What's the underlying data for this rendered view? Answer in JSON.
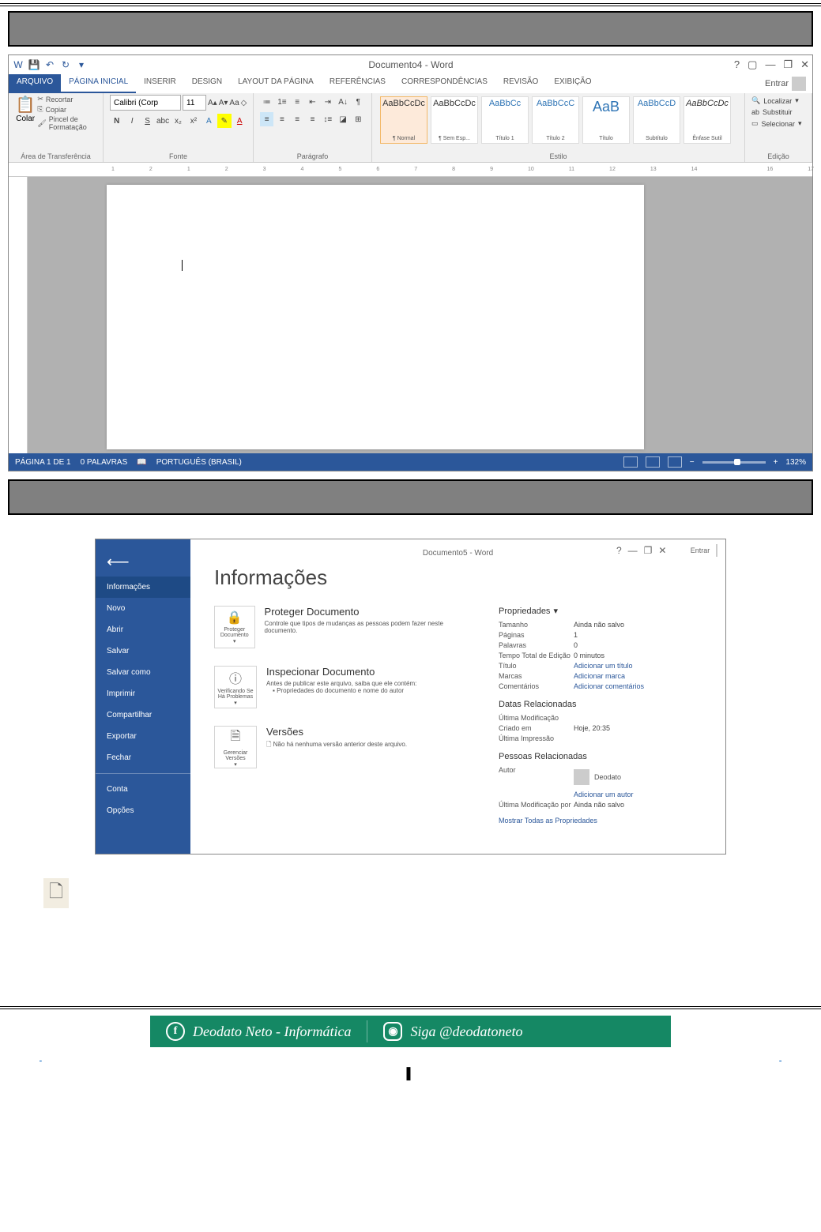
{
  "word_main": {
    "title": "Documento4 - Word",
    "signin": "Entrar",
    "qat_customize": "▾",
    "wincontrols": {
      "help": "?",
      "ribbon_opt": "▢",
      "minimize": "—",
      "restore": "❐",
      "close": "✕"
    },
    "tabs": {
      "file": "ARQUIVO",
      "home": "PÁGINA INICIAL",
      "insert": "INSERIR",
      "design": "DESIGN",
      "layout": "LAYOUT DA PÁGINA",
      "references": "REFERÊNCIAS",
      "mailings": "CORRESPONDÊNCIAS",
      "review": "REVISÃO",
      "view": "EXIBIÇÃO"
    },
    "clipboard": {
      "paste": "Colar",
      "cut": "Recortar",
      "copy": "Copiar",
      "painter": "Pincel de Formatação",
      "label": "Área de Transferência"
    },
    "font": {
      "name": "Calibri (Corp",
      "size": "11",
      "label": "Fonte"
    },
    "para": {
      "label": "Parágrafo"
    },
    "styles": {
      "label": "Estilo",
      "items": [
        {
          "preview": "AaBbCcDc",
          "name": "¶ Normal",
          "cls": ""
        },
        {
          "preview": "AaBbCcDc",
          "name": "¶ Sem Esp...",
          "cls": ""
        },
        {
          "preview": "AaBbCc",
          "name": "Título 1",
          "cls": "blue"
        },
        {
          "preview": "AaBbCcC",
          "name": "Título 2",
          "cls": "blue"
        },
        {
          "preview": "AaB",
          "name": "Título",
          "cls": "big"
        },
        {
          "preview": "AaBbCcD",
          "name": "Subtítulo",
          "cls": "blue"
        },
        {
          "preview": "AaBbCcDc",
          "name": "Ênfase Sutil",
          "cls": ""
        }
      ]
    },
    "editing": {
      "find": "Localizar",
      "replace": "Substituir",
      "select": "Selecionar",
      "label": "Edição"
    },
    "ruler_numbers": [
      "1",
      "2",
      "1",
      "2",
      "3",
      "4",
      "5",
      "6",
      "7",
      "8",
      "9",
      "10",
      "11",
      "12",
      "13",
      "14",
      "",
      "16",
      "17"
    ],
    "status": {
      "page": "PÁGINA 1 DE 1",
      "words": "0 PALAVRAS",
      "lang": "PORTUGUÊS (BRASIL)",
      "zoom_minus": "−",
      "zoom_plus": "+",
      "zoom": "132%"
    }
  },
  "backstage": {
    "title": "Documento5 - Word",
    "signin": "Entrar",
    "wincontrols": {
      "help": "?",
      "minimize": "—",
      "restore": "❐",
      "close": "✕"
    },
    "nav": {
      "info": "Informações",
      "new": "Novo",
      "open": "Abrir",
      "save": "Salvar",
      "saveas": "Salvar como",
      "print": "Imprimir",
      "share": "Compartilhar",
      "export": "Exportar",
      "close": "Fechar",
      "account": "Conta",
      "options": "Opções"
    },
    "h1": "Informações",
    "protect": {
      "btn": "Proteger Documento",
      "title": "Proteger Documento",
      "desc": "Controle que tipos de mudanças as pessoas podem fazer neste documento."
    },
    "inspect": {
      "btn": "Verificando Se Há Problemas",
      "title": "Inspecionar Documento",
      "desc": "Antes de publicar este arquivo, saiba que ele contém:",
      "item": "Propriedades do documento e nome do autor"
    },
    "versions": {
      "btn": "Gerenciar Versões",
      "title": "Versões",
      "desc": "Não há nenhuma versão anterior deste arquivo."
    },
    "props": {
      "header": "Propriedades",
      "size_l": "Tamanho",
      "size_v": "Ainda não salvo",
      "pages_l": "Páginas",
      "pages_v": "1",
      "words_l": "Palavras",
      "words_v": "0",
      "time_l": "Tempo Total de Edição",
      "time_v": "0 minutos",
      "title_l": "Título",
      "title_v": "Adicionar um título",
      "tags_l": "Marcas",
      "tags_v": "Adicionar marca",
      "comments_l": "Comentários",
      "comments_v": "Adicionar comentários"
    },
    "dates": {
      "header": "Datas Relacionadas",
      "lastmod_l": "Última Modificação",
      "created_l": "Criado em",
      "created_v": "Hoje, 20:35",
      "lastprint_l": "Última Impressão"
    },
    "people": {
      "header": "Pessoas Relacionadas",
      "author_l": "Autor",
      "author_v": "Deodato",
      "addauthor": "Adicionar um autor",
      "lastmodby_l": "Última Modificação por",
      "lastmodby_v": "Ainda não salvo"
    },
    "showall": "Mostrar Todas as Propriedades"
  },
  "footer": {
    "fb": "Deodato Neto - Informática",
    "ig": "Siga @deodatoneto"
  }
}
